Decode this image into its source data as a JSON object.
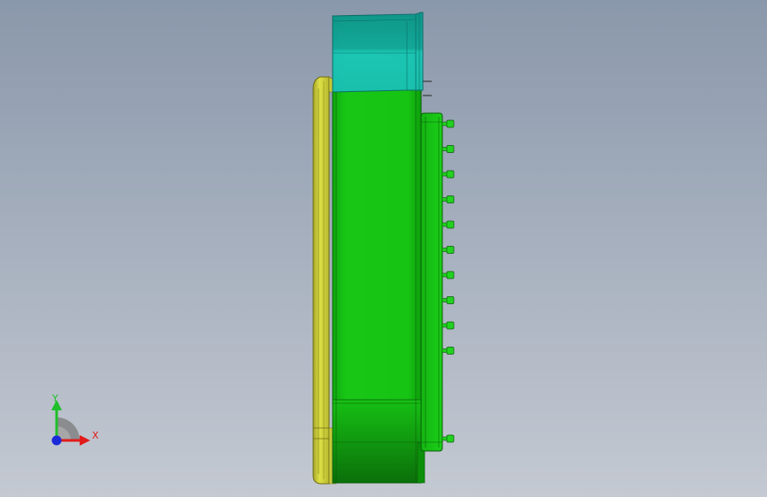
{
  "viewport": {
    "background_top": "#8a98ab",
    "background_bottom": "#c4c9d2"
  },
  "model": {
    "body_color": "#15c313",
    "body_edge_color": "#0a6a08",
    "top_section_color": "#1ec4b7",
    "top_section_dark": "#0f9b93",
    "gasket_color": "#d4d43c",
    "gasket_dark": "#8f8f1e",
    "pin_color": "#21d21f",
    "pin_count": 11
  },
  "triad": {
    "x_label": "X",
    "y_label": "Y",
    "x_color": "#e11b1b",
    "y_color": "#1fbf2a",
    "z_color": "#1a2ad8"
  }
}
